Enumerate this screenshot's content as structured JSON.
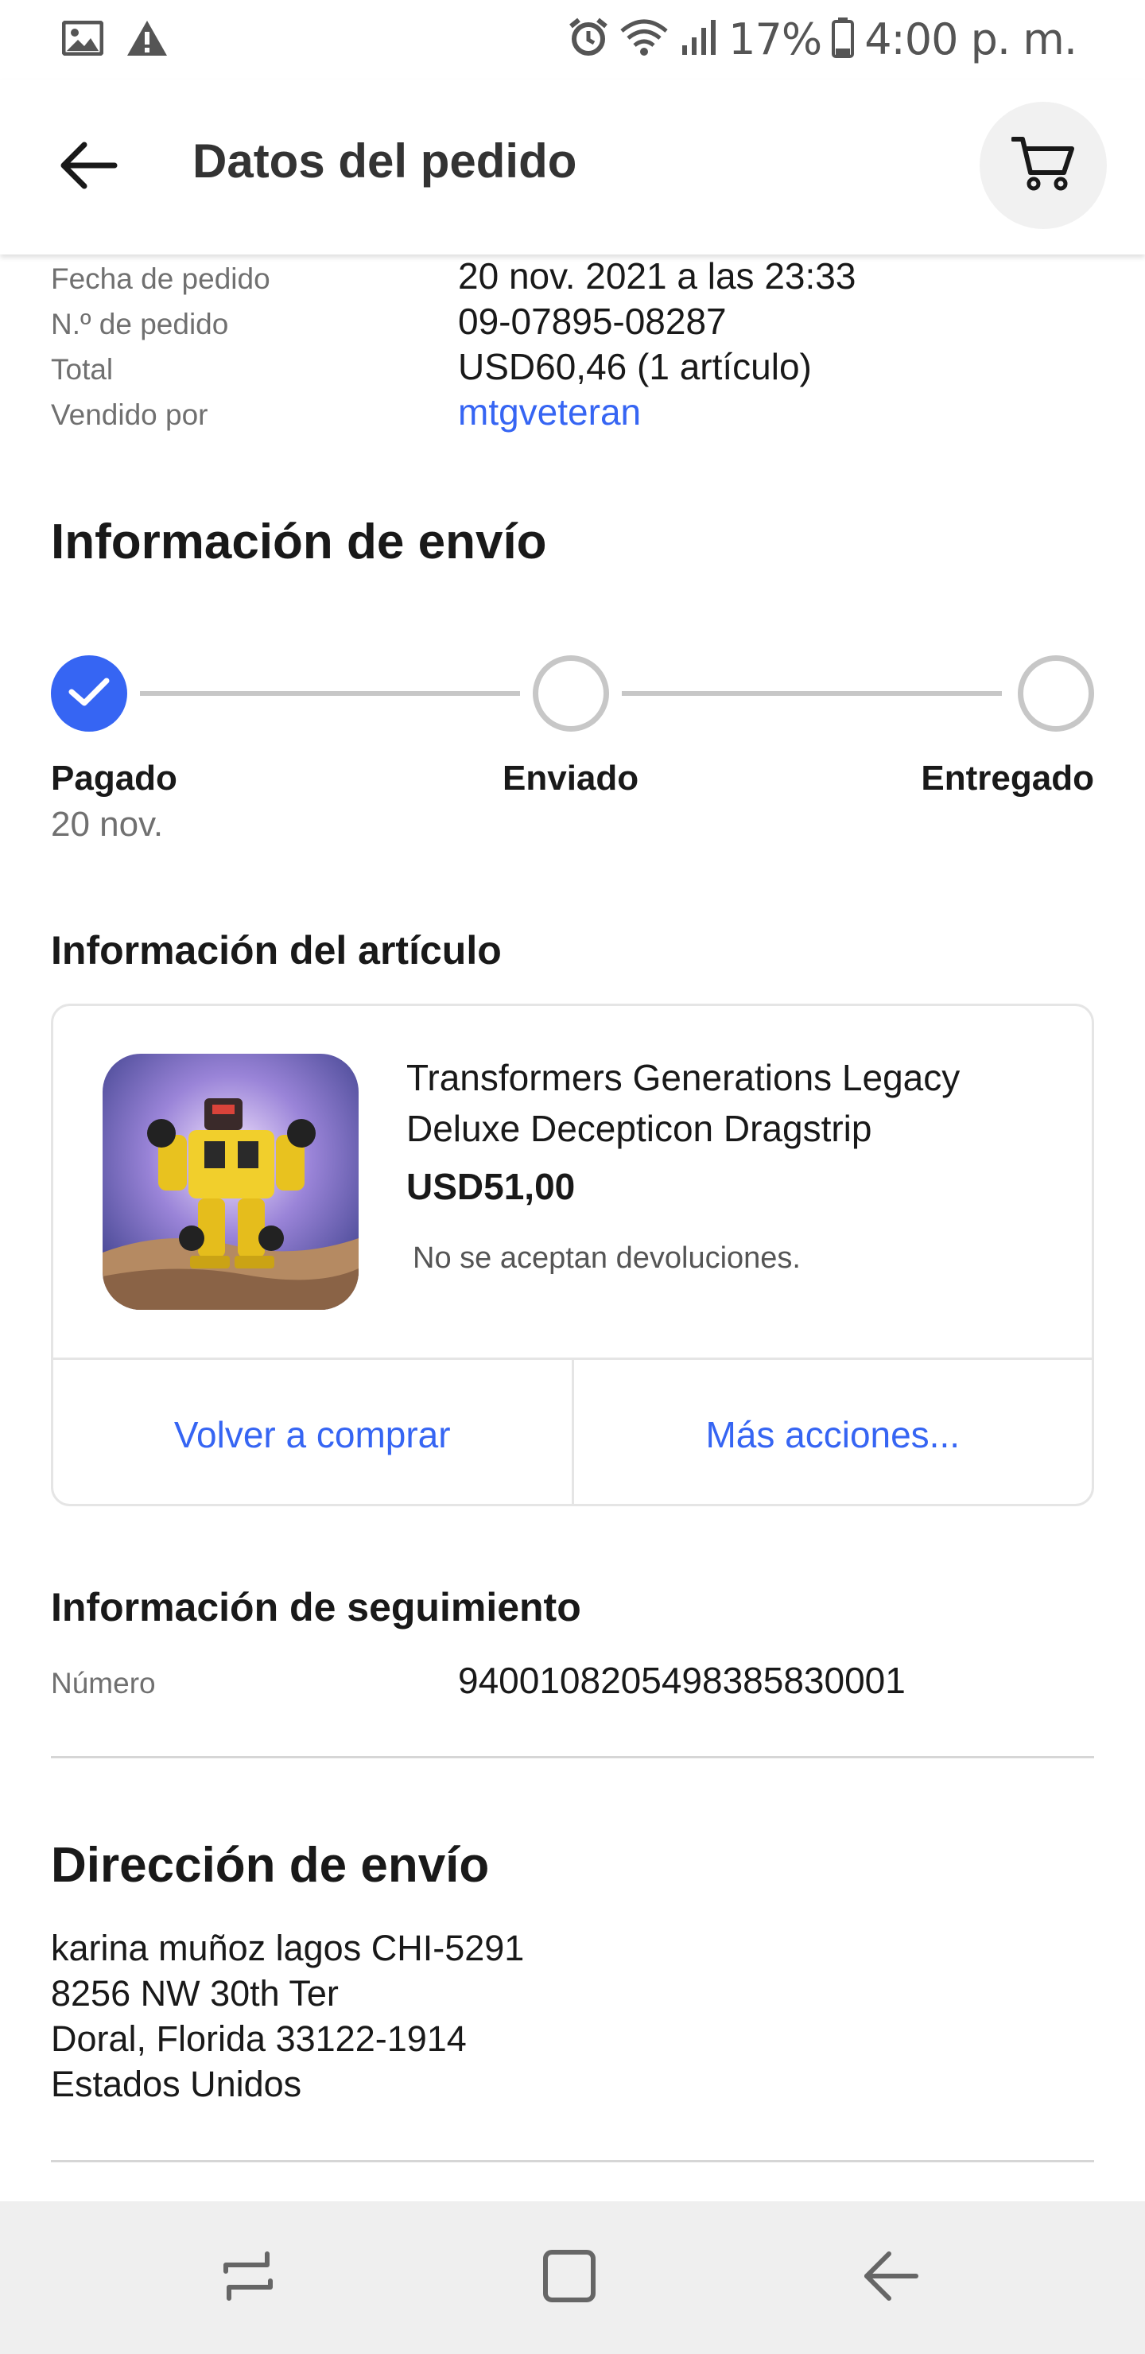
{
  "status_bar": {
    "battery": "17%",
    "time": "4:00 p. m.",
    "icons": [
      "image-icon",
      "warning-icon",
      "alarm-icon",
      "wifi-icon",
      "signal-icon",
      "battery-icon"
    ]
  },
  "header": {
    "title": "Datos del pedido",
    "back_icon": "arrow-left-icon",
    "cart_icon": "cart-icon"
  },
  "order": {
    "rows": [
      {
        "label": "Fecha de pedido",
        "value": "20 nov. 2021 a las 23:33"
      },
      {
        "label": "N.º de pedido",
        "value": "09-07895-08287"
      },
      {
        "label": "Total",
        "value": "USD60,46 (1 artículo)"
      },
      {
        "label": "Vendido por",
        "value": "mtgveteran"
      }
    ]
  },
  "shipping_info": {
    "title": "Información de envío",
    "steps": [
      {
        "label": "Pagado",
        "date": "20 nov.",
        "status": "complete"
      },
      {
        "label": "Enviado",
        "status": "pending"
      },
      {
        "label": "Entregado",
        "status": "pending"
      }
    ]
  },
  "item_info": {
    "title": "Información del artículo",
    "item_title": "Transformers Generations Legacy Deluxe Decepticon Dragstrip",
    "price": "USD51,00",
    "returns": "No se aceptan devoluciones.",
    "buy_again": "Volver a comprar",
    "more_actions": "Más acciones..."
  },
  "tracking": {
    "title": "Información de seguimiento",
    "label": "Número",
    "number": "9400108205498385830001"
  },
  "address": {
    "title": "Dirección de envío",
    "lines": [
      "karina muñoz lagos CHI-5291",
      "8256 NW 30th Ter",
      "Doral, Florida 33122-1914",
      "Estados Unidos"
    ]
  },
  "nav_bar": {
    "buttons": [
      "recents-icon",
      "home-icon",
      "back-icon"
    ]
  },
  "colors": {
    "accent": "#3665f3",
    "text": "#191919",
    "muted": "#707070",
    "border": "#e5e5e5"
  }
}
